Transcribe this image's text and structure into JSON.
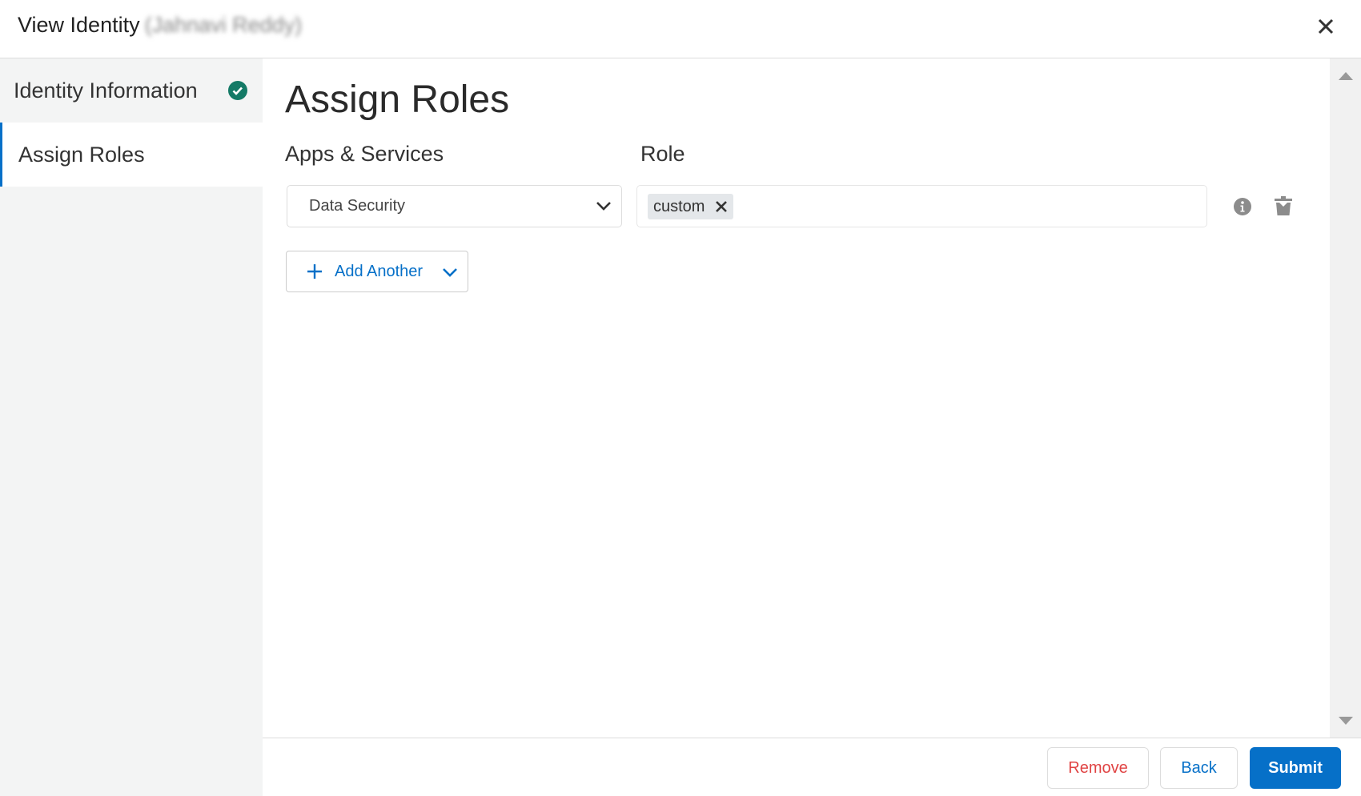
{
  "header": {
    "title": "View Identity",
    "name_redacted": "(Jahnavi Reddy)",
    "close_icon": "close-icon"
  },
  "sidebar": {
    "items": [
      {
        "label": "Identity Information",
        "status": "complete"
      },
      {
        "label": "Assign Roles",
        "active": true
      }
    ]
  },
  "main": {
    "heading": "Assign Roles",
    "col_apps": "Apps & Services",
    "col_role": "Role",
    "rows": [
      {
        "app": "Data Security",
        "roles": [
          "custom"
        ]
      }
    ],
    "add_another": "Add Another"
  },
  "footer": {
    "remove": "Remove",
    "back": "Back",
    "submit": "Submit"
  },
  "colors": {
    "accent": "#0670c8",
    "danger": "#e04444",
    "success": "#147a66"
  }
}
